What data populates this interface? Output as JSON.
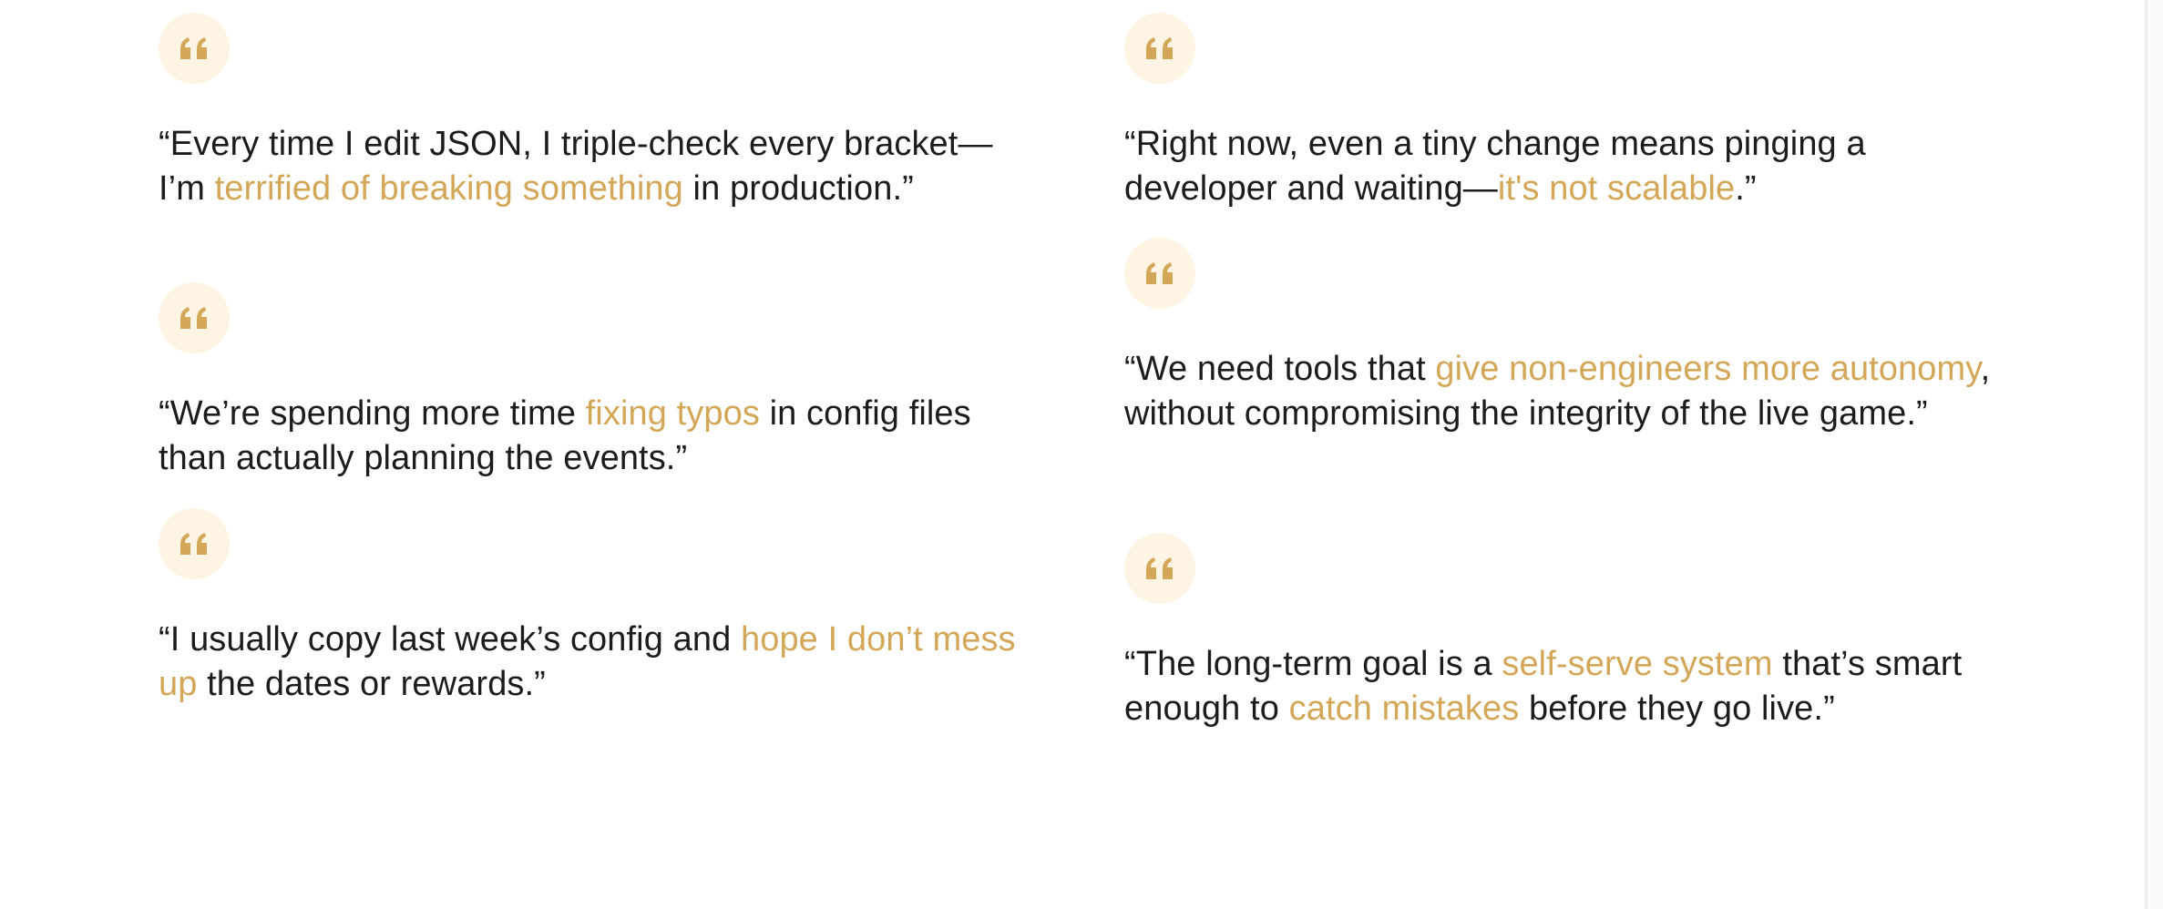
{
  "colors": {
    "accent": "#d4a758",
    "icon_bg": "#fdf4e4",
    "text": "#1c1c1c"
  },
  "quotes": [
    {
      "icon": "quote-icon",
      "segments": [
        {
          "text": "“Every time I edit JSON, I triple-check every bracket—I’m ",
          "highlight": false
        },
        {
          "text": "terrified of breaking something",
          "highlight": true
        },
        {
          "text": " in production.”",
          "highlight": false
        }
      ]
    },
    {
      "icon": "quote-icon",
      "segments": [
        {
          "text": "“We’re spending more time ",
          "highlight": false
        },
        {
          "text": "fixing typos",
          "highlight": true
        },
        {
          "text": " in config files than actually planning the events.”",
          "highlight": false
        }
      ]
    },
    {
      "icon": "quote-icon",
      "segments": [
        {
          "text": "“I usually copy last week’s config and ",
          "highlight": false
        },
        {
          "text": "hope I don’t mess up",
          "highlight": true
        },
        {
          "text": " the dates or rewards.”",
          "highlight": false
        }
      ]
    },
    {
      "icon": "quote-icon",
      "segments": [
        {
          "text": "“Right now, even a tiny change means pinging a developer and waiting—",
          "highlight": false
        },
        {
          "text": "it's not scalable",
          "highlight": true
        },
        {
          "text": ".”",
          "highlight": false
        }
      ]
    },
    {
      "icon": "quote-icon",
      "segments": [
        {
          "text": "“We need tools that ",
          "highlight": false
        },
        {
          "text": "give non-engineers more autonomy",
          "highlight": true
        },
        {
          "text": ", without compromising the integrity of the live game.”",
          "highlight": false
        }
      ]
    },
    {
      "icon": "quote-icon",
      "segments": [
        {
          "text": "“The long-term goal is a ",
          "highlight": false
        },
        {
          "text": "self-serve system",
          "highlight": true
        },
        {
          "text": " that’s smart enough to ",
          "highlight": false
        },
        {
          "text": "catch mistakes",
          "highlight": true
        },
        {
          "text": " before they go live.”",
          "highlight": false
        }
      ]
    }
  ]
}
